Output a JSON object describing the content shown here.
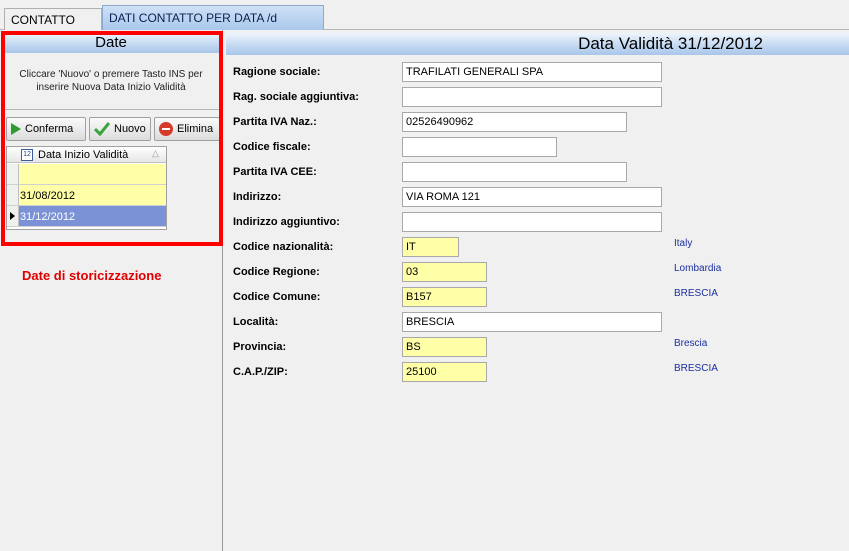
{
  "tabs": {
    "contatto": "CONTATTO",
    "dati_contatto": "DATI CONTATTO PER DATA /d"
  },
  "left": {
    "header": "Date",
    "instructions": "Cliccare 'Nuovo' o premere Tasto INS per inserire Nuova Data Inizio Validità",
    "buttons": {
      "conferma": "Conferma",
      "nuovo": "Nuovo",
      "elimina": "Elimina"
    },
    "grid": {
      "column": "Data Inizio Validità",
      "rows": [
        "",
        "31/08/2012",
        "31/12/2012"
      ],
      "selected_index": 2
    },
    "annotation": "Date di storicizzazione"
  },
  "right": {
    "title": "Data Validità 31/12/2012",
    "fields": {
      "ragione_sociale": {
        "label": "Ragione sociale:",
        "value": "TRAFILATI GENERALI SPA"
      },
      "rag_sociale_agg": {
        "label": "Rag. sociale aggiuntiva:",
        "value": ""
      },
      "partita_iva": {
        "label": "Partita IVA Naz.:",
        "value": "02526490962"
      },
      "codice_fiscale": {
        "label": "Codice fiscale:",
        "value": ""
      },
      "partita_iva_cee": {
        "label": "Partita IVA CEE:",
        "value": ""
      },
      "indirizzo": {
        "label": "Indirizzo:",
        "value": "VIA ROMA 121"
      },
      "indirizzo_agg": {
        "label": "Indirizzo aggiuntivo:",
        "value": ""
      },
      "codice_nazionalita": {
        "label": "Codice nazionalità:",
        "value": "IT",
        "desc": "Italy"
      },
      "codice_regione": {
        "label": "Codice Regione:",
        "value": "03",
        "desc": "Lombardia"
      },
      "codice_comune": {
        "label": "Codice Comune:",
        "value": "B157",
        "desc": "BRESCIA"
      },
      "localita": {
        "label": "Località:",
        "value": "BRESCIA"
      },
      "provincia": {
        "label": "Provincia:",
        "value": "BS",
        "desc": "Brescia"
      },
      "cap": {
        "label": "C.A.P./ZIP:",
        "value": "25100",
        "desc": "BRESCIA"
      }
    }
  },
  "colors": {
    "accent_blue": "#a8c6ea",
    "highlight_yellow": "#ffffa8",
    "selection": "#7b93d6",
    "annotation_red": "#ff0000"
  }
}
